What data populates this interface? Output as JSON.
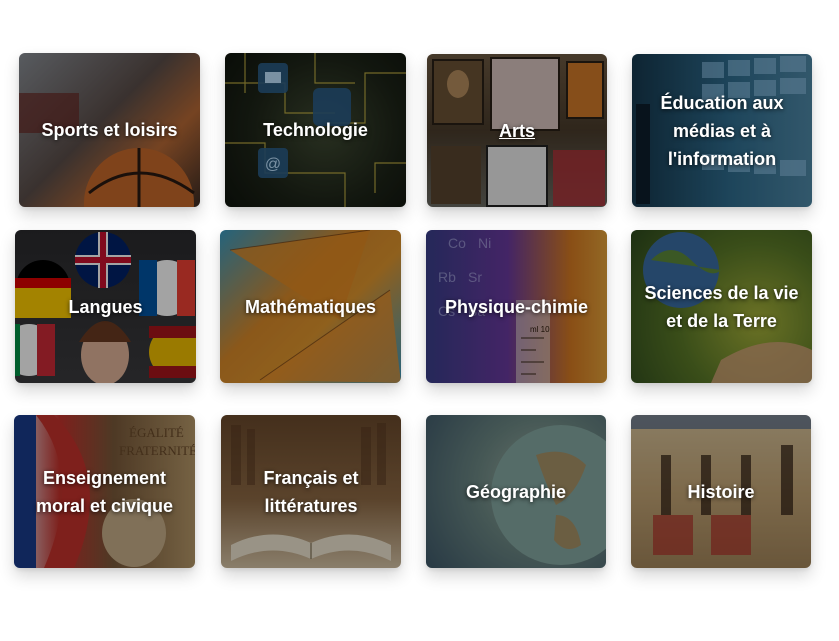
{
  "subjects": [
    {
      "label": "Sports et loisirs"
    },
    {
      "label": "Technologie"
    },
    {
      "label": "Arts"
    },
    {
      "label": "Éducation aux\nmédias et à\nl'information"
    },
    {
      "label": "Langues"
    },
    {
      "label": "Mathématiques"
    },
    {
      "label": "Physique-chimie"
    },
    {
      "label": "Sciences de la vie\net de la Terre"
    },
    {
      "label": "Enseignement\nmoral et civique"
    },
    {
      "label": "Français et\nlittératures"
    },
    {
      "label": "Géographie"
    },
    {
      "label": "Histoire"
    }
  ],
  "image_text": {
    "physics_scale": "ml 10",
    "civics_banner": "ÉGALITÉ\nFRATERNITÉ"
  }
}
